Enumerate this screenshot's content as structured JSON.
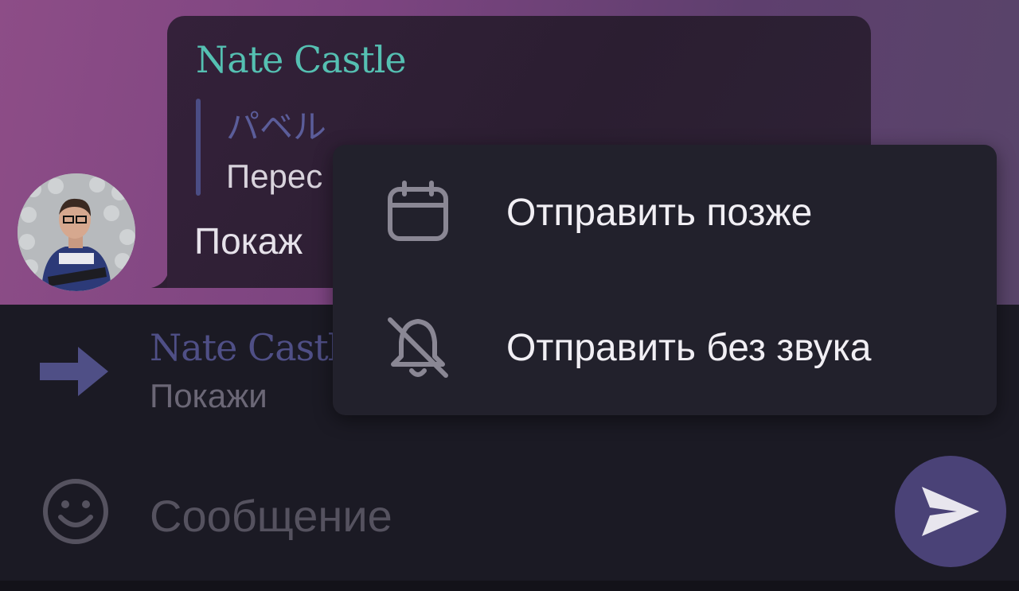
{
  "chat": {
    "message": {
      "sender": "Nate Castle",
      "quote_author": "パベル",
      "quote_text": "Перес",
      "text": "Покаж"
    }
  },
  "reply": {
    "name": "Nate Castl",
    "text": "Покажи"
  },
  "composer": {
    "placeholder": "Сообщение"
  },
  "send_menu": {
    "items": [
      {
        "label": "Отправить позже",
        "icon": "calendar-icon"
      },
      {
        "label": "Отправить без звука",
        "icon": "bell-off-icon"
      }
    ]
  },
  "colors": {
    "accent": "#4a4277",
    "sender_name": "#55c0b2",
    "quote_bar": "#4b4d84"
  }
}
